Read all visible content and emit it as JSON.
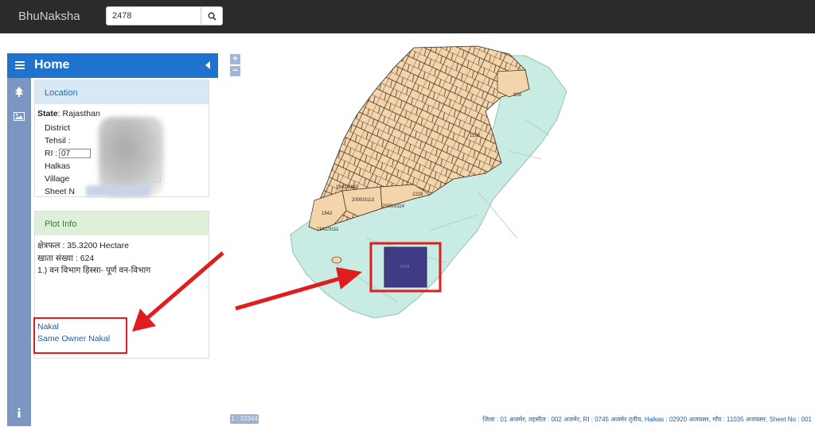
{
  "app": {
    "title": "BhuNaksha"
  },
  "search": {
    "value": "2478",
    "icon": "search-icon"
  },
  "sidebar": {
    "title": "Home",
    "rail_icons": [
      "tree-icon",
      "image-icon",
      "info-icon"
    ]
  },
  "location": {
    "header": "Location",
    "state_label": "State",
    "state_value": "Rajasthan",
    "district_label": "District",
    "tehsil_label": "Tehsil :",
    "ri_label": "RI :",
    "ri_value": "07",
    "halkas_label": "Halkas",
    "village_label": "Village",
    "sheet_label": "Sheet N"
  },
  "plot_info": {
    "header": "Plot Info",
    "area": "क्षेत्रफल : 35.3200 Hectare",
    "khata": "खाता संख्या : 624",
    "owner": "1.) वन विभाग हिस्सा- पूर्ण वन-विभाग",
    "links": [
      "Nakal",
      "Same Owner Nakal"
    ]
  },
  "map": {
    "zoom_in": "+",
    "zoom_out": "−",
    "labels": {
      "p909": "909",
      "p2000_3113": "2000/3113",
      "p2000_3114": "2000/3114",
      "p2228": "2228",
      "p1942": "1942",
      "p1942_2842": "1942/2842",
      "p1942_3111": "1942/3111",
      "p1136": "1136",
      "p2478": "2478"
    },
    "scale": "1 : 33344"
  },
  "footer": {
    "text": "जिला : 01 अजमेर, तहसील : 002 अजमेर, RI : 0745 अजमेर तृतीय, Halkas : 02920 अजयसर, गाँव : 11035 अजयसर, Sheet No : 001"
  },
  "colors": {
    "topbar": "#2b2b2b",
    "sidebar_header": "#1f73cf",
    "rail": "#7b96c1",
    "map_green": "#c8ebe3",
    "map_parcel": "#f3d4ab",
    "selected_plot": "#3f3b85",
    "annotation_red": "#e01c1c"
  }
}
